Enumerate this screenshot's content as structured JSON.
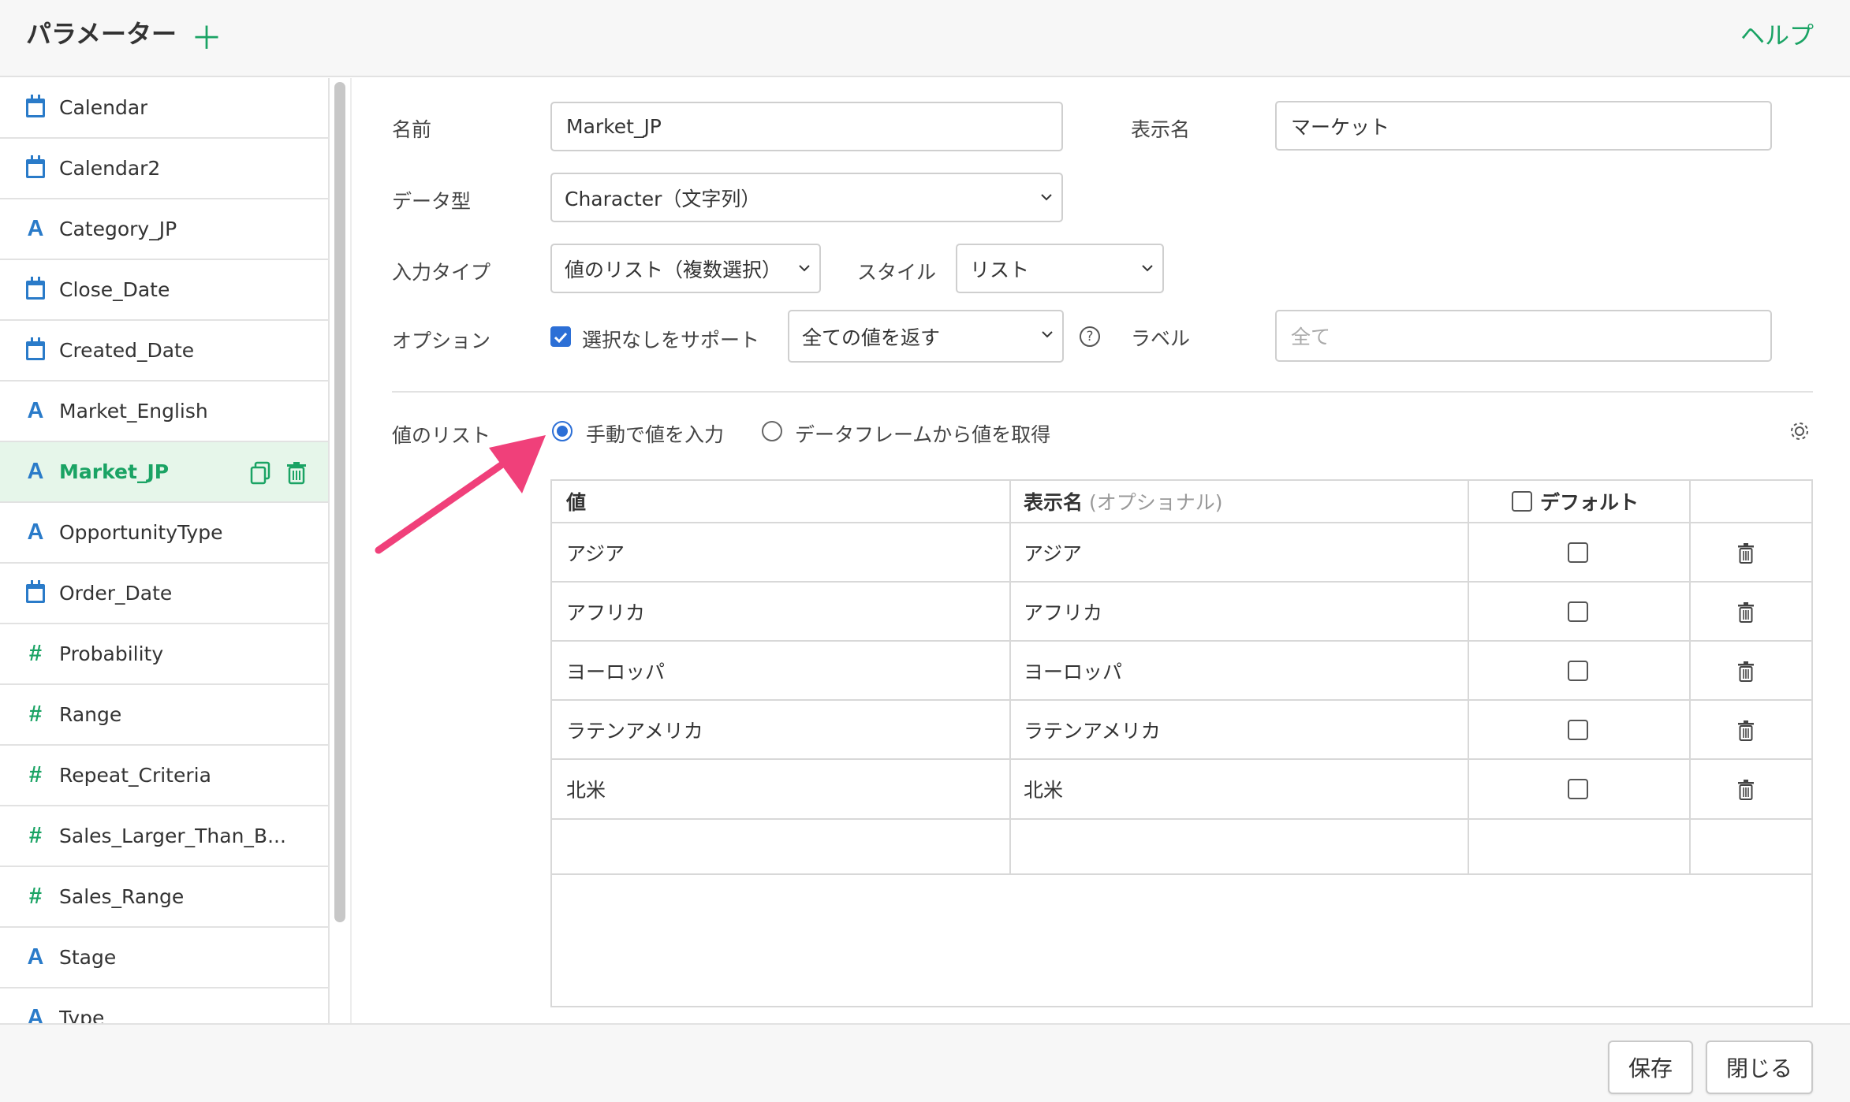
{
  "header": {
    "title": "パラメーター",
    "add_icon": "＋",
    "help": "ヘルプ"
  },
  "sidebar": {
    "items": [
      {
        "label": "Calendar",
        "icon": "calendar-icon"
      },
      {
        "label": "Calendar2",
        "icon": "calendar-icon"
      },
      {
        "label": "Category_JP",
        "icon": "character-icon"
      },
      {
        "label": "Close_Date",
        "icon": "calendar-icon"
      },
      {
        "label": "Created_Date",
        "icon": "calendar-icon"
      },
      {
        "label": "Market_English",
        "icon": "character-icon"
      },
      {
        "label": "Market_JP",
        "icon": "character-icon",
        "selected": true
      },
      {
        "label": "OpportunityType",
        "icon": "character-icon"
      },
      {
        "label": "Order_Date",
        "icon": "calendar-icon"
      },
      {
        "label": "Probability",
        "icon": "number-icon"
      },
      {
        "label": "Range",
        "icon": "number-icon"
      },
      {
        "label": "Repeat_Criteria",
        "icon": "number-icon"
      },
      {
        "label": "Sales_Larger_Than_B...",
        "icon": "number-icon"
      },
      {
        "label": "Sales_Range",
        "icon": "number-icon"
      },
      {
        "label": "Stage",
        "icon": "character-icon"
      },
      {
        "label": "Type",
        "icon": "character-icon"
      }
    ],
    "glyphs": {
      "character": "A",
      "number": "#"
    }
  },
  "form": {
    "name_label": "名前",
    "name_value": "Market_JP",
    "display_name_label": "表示名",
    "display_name_value": "マーケット",
    "data_type_label": "データ型",
    "data_type_value": "Character（文字列）",
    "input_type_label": "入力タイプ",
    "input_type_value": "値のリスト（複数選択）",
    "style_label": "スタイル",
    "style_value": "リスト",
    "option_label": "オプション",
    "support_none_label": "選択なしをサポート",
    "support_none_checked": true,
    "return_all_value": "全ての値を返す",
    "help_glyph": "?",
    "label_label": "ラベル",
    "label_placeholder": "全て"
  },
  "values_list": {
    "label": "値のリスト",
    "manual_label": "手動で値を入力",
    "manual_selected": true,
    "dataframe_label": "データフレームから値を取得",
    "columns": {
      "value": "値",
      "display": "表示名",
      "display_sub": "(オプショナル)",
      "default": "デフォルト"
    },
    "rows": [
      {
        "value": "アジア",
        "display": "アジア",
        "default": false
      },
      {
        "value": "アフリカ",
        "display": "アフリカ",
        "default": false
      },
      {
        "value": "ヨーロッパ",
        "display": "ヨーロッパ",
        "default": false
      },
      {
        "value": "ラテンアメリカ",
        "display": "ラテンアメリカ",
        "default": false
      },
      {
        "value": "北米",
        "display": "北米",
        "default": false
      }
    ]
  },
  "footer": {
    "save": "保存",
    "close": "閉じる"
  },
  "colors": {
    "accent": "#1aa364",
    "selected_bg": "#e6f6ea",
    "checkbox_blue": "#2c6fd6",
    "annotation_arrow": "#f0407a"
  }
}
